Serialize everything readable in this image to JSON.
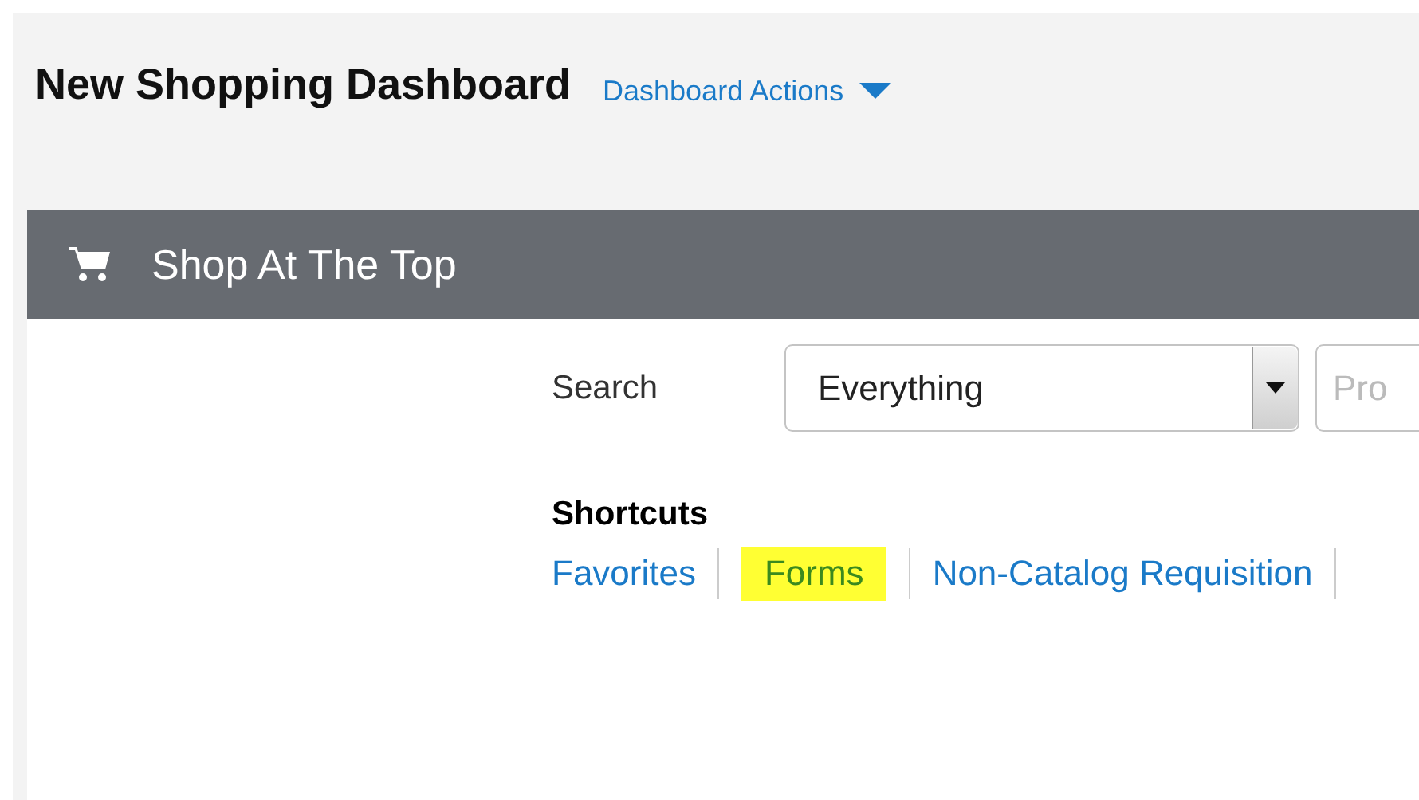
{
  "page": {
    "title": "New Shopping Dashboard",
    "actions_menu": "Dashboard Actions"
  },
  "panel": {
    "title": "Shop At The Top",
    "search": {
      "label": "Search",
      "scope": "Everything",
      "placeholder": "Pro"
    },
    "shortcuts": {
      "heading": "Shortcuts",
      "links": [
        {
          "label": "Favorites",
          "highlighted": false
        },
        {
          "label": "Forms",
          "highlighted": true
        },
        {
          "label": "Non-Catalog Requisition",
          "highlighted": false
        }
      ]
    }
  }
}
